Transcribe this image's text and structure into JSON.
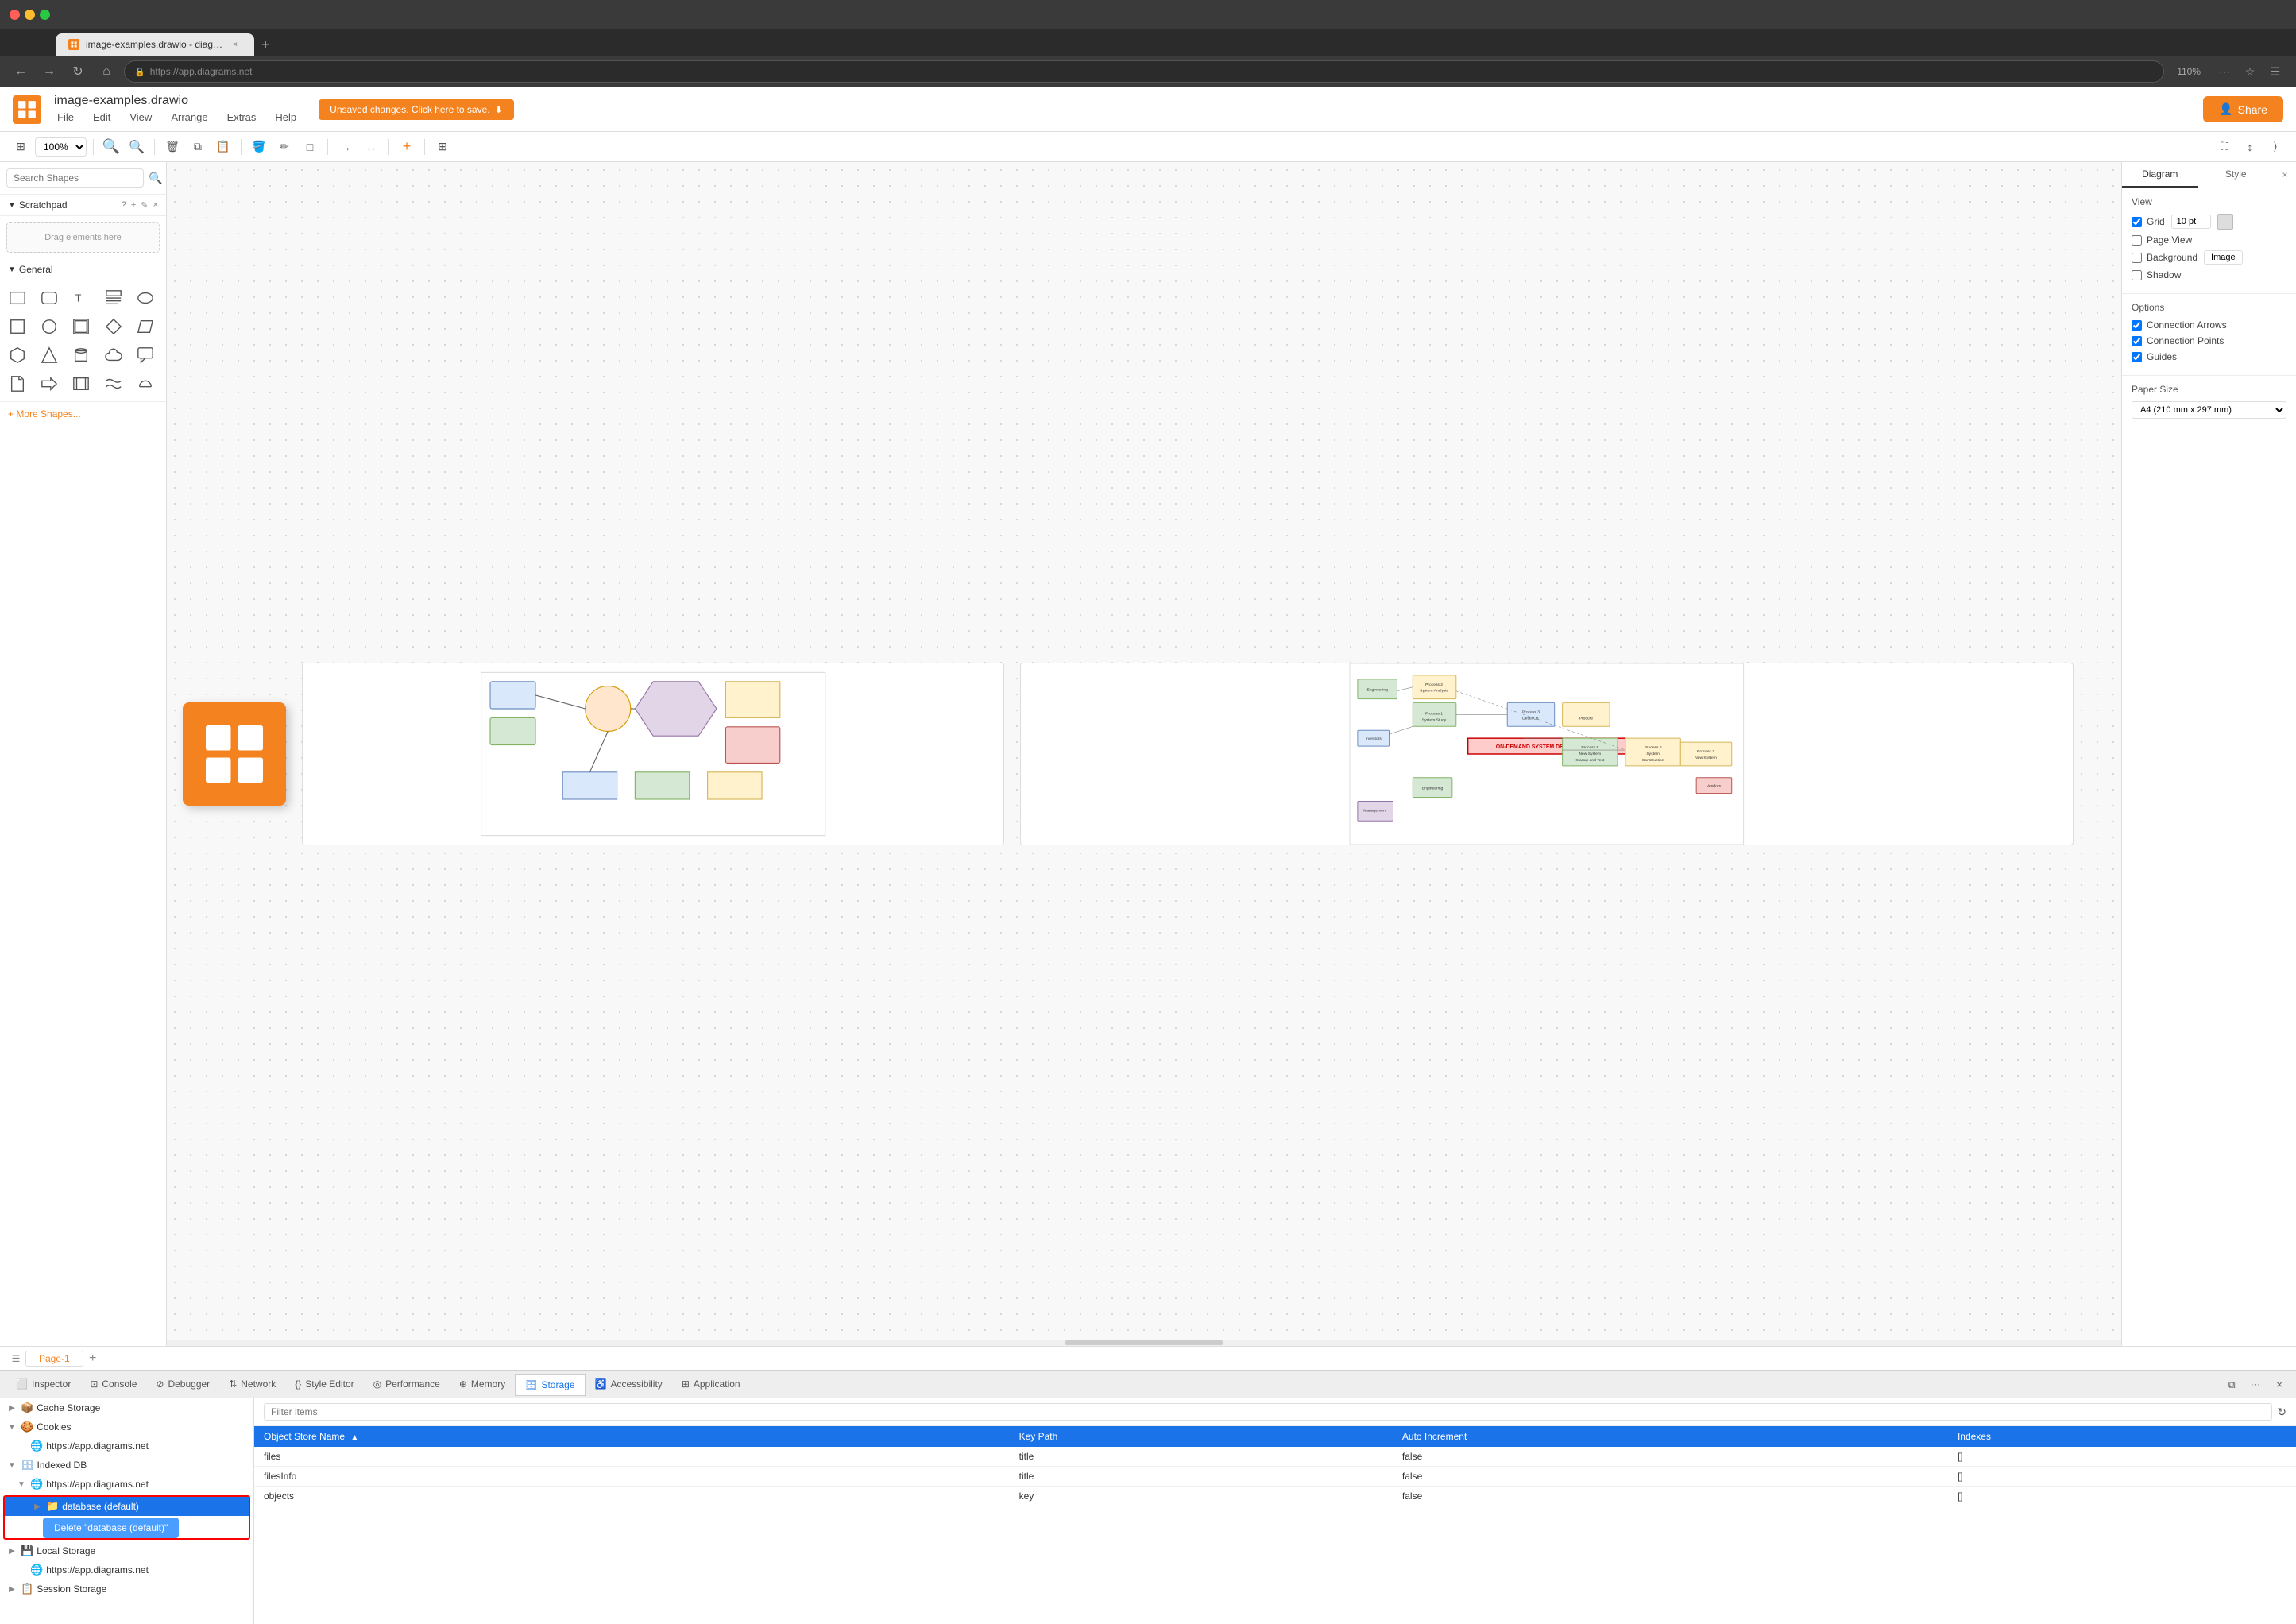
{
  "browser": {
    "tab_title": "image-examples.drawio - diag…",
    "tab_favicon": "drawio",
    "new_tab_btn": "+",
    "url": "https://app.diagrams.net",
    "url_prefix": "https://app.",
    "url_domain": "diagrams.net",
    "zoom_level": "110%",
    "nav_back": "←",
    "nav_forward": "→",
    "nav_refresh": "↻",
    "nav_home": "⌂"
  },
  "app": {
    "title": "image-examples.drawio",
    "logo_alt": "drawio-logo",
    "menu": [
      "File",
      "Edit",
      "View",
      "Arrange",
      "Extras",
      "Help"
    ],
    "save_badge": "Unsaved changes. Click here to save.",
    "share_btn": "Share"
  },
  "toolbar": {
    "zoom_value": "100%",
    "zoom_in": "+",
    "zoom_out": "−"
  },
  "sidebar": {
    "search_placeholder": "Search Shapes",
    "scratchpad_label": "Scratchpad",
    "scratchpad_help": "?",
    "scratchpad_add": "+",
    "scratchpad_edit": "✎",
    "scratchpad_close": "×",
    "drag_hint": "Drag elements here",
    "general_label": "General",
    "text_label": "Text",
    "more_shapes": "+ More Shapes..."
  },
  "right_panel": {
    "tab_diagram": "Diagram",
    "tab_style": "Style",
    "close": "×",
    "view_section": "View",
    "grid_label": "Grid",
    "grid_value": "10 pt",
    "page_view_label": "Page View",
    "background_label": "Background",
    "background_value": "Image",
    "shadow_label": "Shadow",
    "options_section": "Options",
    "connection_arrows": "Connection Arrows",
    "connection_points": "Connection Points",
    "guides": "Guides",
    "paper_size_section": "Paper Size",
    "paper_size_value": "A4 (210 mm x 297 mm)"
  },
  "devtools": {
    "tabs": [
      "Inspector",
      "Console",
      "Debugger",
      "Network",
      "Style Editor",
      "Performance",
      "Memory",
      "Storage",
      "Accessibility",
      "Application"
    ],
    "active_tab": "Storage",
    "filter_placeholder": "Filter items",
    "refresh_btn": "↻",
    "close_btn": "×",
    "expand_btn": "⋯",
    "new_tab_btn": "⧉"
  },
  "storage_tree": {
    "items": [
      {
        "label": "Cache Storage",
        "level": 0,
        "expanded": false,
        "icon": "cache"
      },
      {
        "label": "Cookies",
        "level": 0,
        "expanded": true,
        "icon": "cookies"
      },
      {
        "label": "https://app.diagrams.net",
        "level": 1,
        "icon": "globe"
      },
      {
        "label": "Indexed DB",
        "level": 0,
        "expanded": true,
        "icon": "indexeddb"
      },
      {
        "label": "https://app.diagrams.net",
        "level": 1,
        "icon": "globe"
      },
      {
        "label": "database (default)",
        "level": 2,
        "icon": "folder",
        "selected": true
      },
      {
        "label": "Local Storage",
        "level": 0,
        "expanded": false,
        "icon": "storage"
      },
      {
        "label": "https://app.diagrams.net",
        "level": 1,
        "icon": "globe"
      },
      {
        "label": "Session Storage",
        "level": 0,
        "expanded": false,
        "icon": "session"
      }
    ],
    "context_menu_label": "Delete \"database (default)\""
  },
  "storage_table": {
    "columns": [
      "Object Store Name",
      "Key Path",
      "Auto Increment",
      "Indexes"
    ],
    "rows": [
      {
        "name": "files",
        "key_path": "title",
        "auto_increment": "false",
        "indexes": "[]"
      },
      {
        "name": "filesInfo",
        "key_path": "title",
        "auto_increment": "false",
        "indexes": "[]"
      },
      {
        "name": "objects",
        "key_path": "key",
        "auto_increment": "false",
        "indexes": "[]"
      }
    ]
  },
  "page_tabs": {
    "page1": "Page-1",
    "add": "+",
    "menu": "≡"
  }
}
